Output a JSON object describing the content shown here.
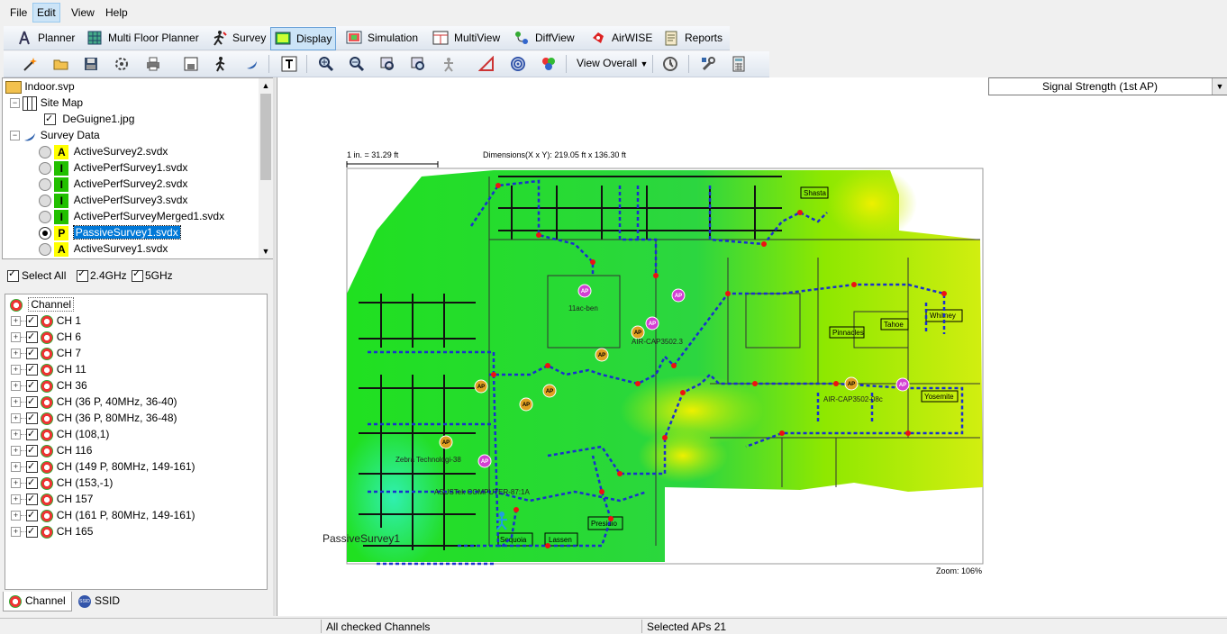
{
  "menu": [
    "File",
    "Edit",
    "View",
    "Help"
  ],
  "menu_active": "Edit",
  "modes": [
    {
      "label": "Planner",
      "icon": "planner-icon"
    },
    {
      "label": "Multi Floor Planner",
      "icon": "multi-floor-icon"
    },
    {
      "label": "Survey",
      "icon": "survey-walker-icon"
    },
    {
      "label": "Display",
      "icon": "display-icon"
    },
    {
      "label": "Simulation",
      "icon": "simulation-icon"
    },
    {
      "label": "MultiView",
      "icon": "multiview-icon"
    },
    {
      "label": "DiffView",
      "icon": "diffview-icon"
    },
    {
      "label": "AirWISE",
      "icon": "airwise-icon"
    },
    {
      "label": "Reports",
      "icon": "reports-icon"
    }
  ],
  "mode_active": "Display",
  "toolbar": {
    "view_overall": "View Overall"
  },
  "project_tree": {
    "root": "Indoor.svp",
    "site_map": "Site Map",
    "site_map_file": "DeGuigne1.jpg",
    "survey_data": "Survey Data",
    "surveys": [
      {
        "badge": "A",
        "name": "ActiveSurvey2.svdx",
        "selected": false
      },
      {
        "badge": "I",
        "name": "ActivePerfSurvey1.svdx",
        "selected": false
      },
      {
        "badge": "I",
        "name": "ActivePerfSurvey2.svdx",
        "selected": false
      },
      {
        "badge": "I",
        "name": "ActivePerfSurvey3.svdx",
        "selected": false
      },
      {
        "badge": "I",
        "name": "ActivePerfSurveyMerged1.svdx",
        "selected": false
      },
      {
        "badge": "P",
        "name": "PassiveSurvey1.svdx",
        "selected": true
      },
      {
        "badge": "A",
        "name": "ActiveSurvey1.svdx",
        "selected": false
      }
    ]
  },
  "filters": {
    "select_all": "Select All",
    "band_24": "2.4GHz",
    "band_5": "5GHz"
  },
  "channel_panel": {
    "header": "Channel",
    "channels": [
      "CH 1",
      "CH 6",
      "CH 7",
      "CH 11",
      "CH 36",
      "CH (36 P, 40MHz, 36-40)",
      "CH (36 P, 80MHz, 36-48)",
      "CH (108,1)",
      "CH 116",
      "CH (149 P, 80MHz, 149-161)",
      "CH (153,-1)",
      "CH 157",
      "CH (161 P, 80MHz, 149-161)",
      "CH 165"
    ]
  },
  "bottom_tabs": [
    {
      "label": "Channel",
      "active": true
    },
    {
      "label": "SSID",
      "active": false
    }
  ],
  "visualization": "Signal Strength (1st AP)",
  "map": {
    "scale": "1 in. = 31.29 ft",
    "dimensions": "Dimensions(X x Y): 219.05 ft x 136.30 ft",
    "zoom": "Zoom: 106%",
    "survey_label": "PassiveSurvey1",
    "rooms": [
      "Shasta",
      "Tahoe",
      "Whitney",
      "Pinnacles",
      "Yosemite",
      "Presidio",
      "Sequoia",
      "Lassen"
    ],
    "ap_labels": [
      "11ac-ben",
      "Zebra Technologi-38",
      "ASUSTek COMPUTER-87:1A",
      "AIR-CAP3502-08c",
      "AIR-CAP3502.3"
    ],
    "colors": {
      "strong": "#00d040",
      "mid": "#7be000",
      "weak": "#e6f000",
      "low": "#30e8a0"
    }
  },
  "status": {
    "channels": "All checked Channels",
    "selected_aps": "Selected APs 21"
  }
}
